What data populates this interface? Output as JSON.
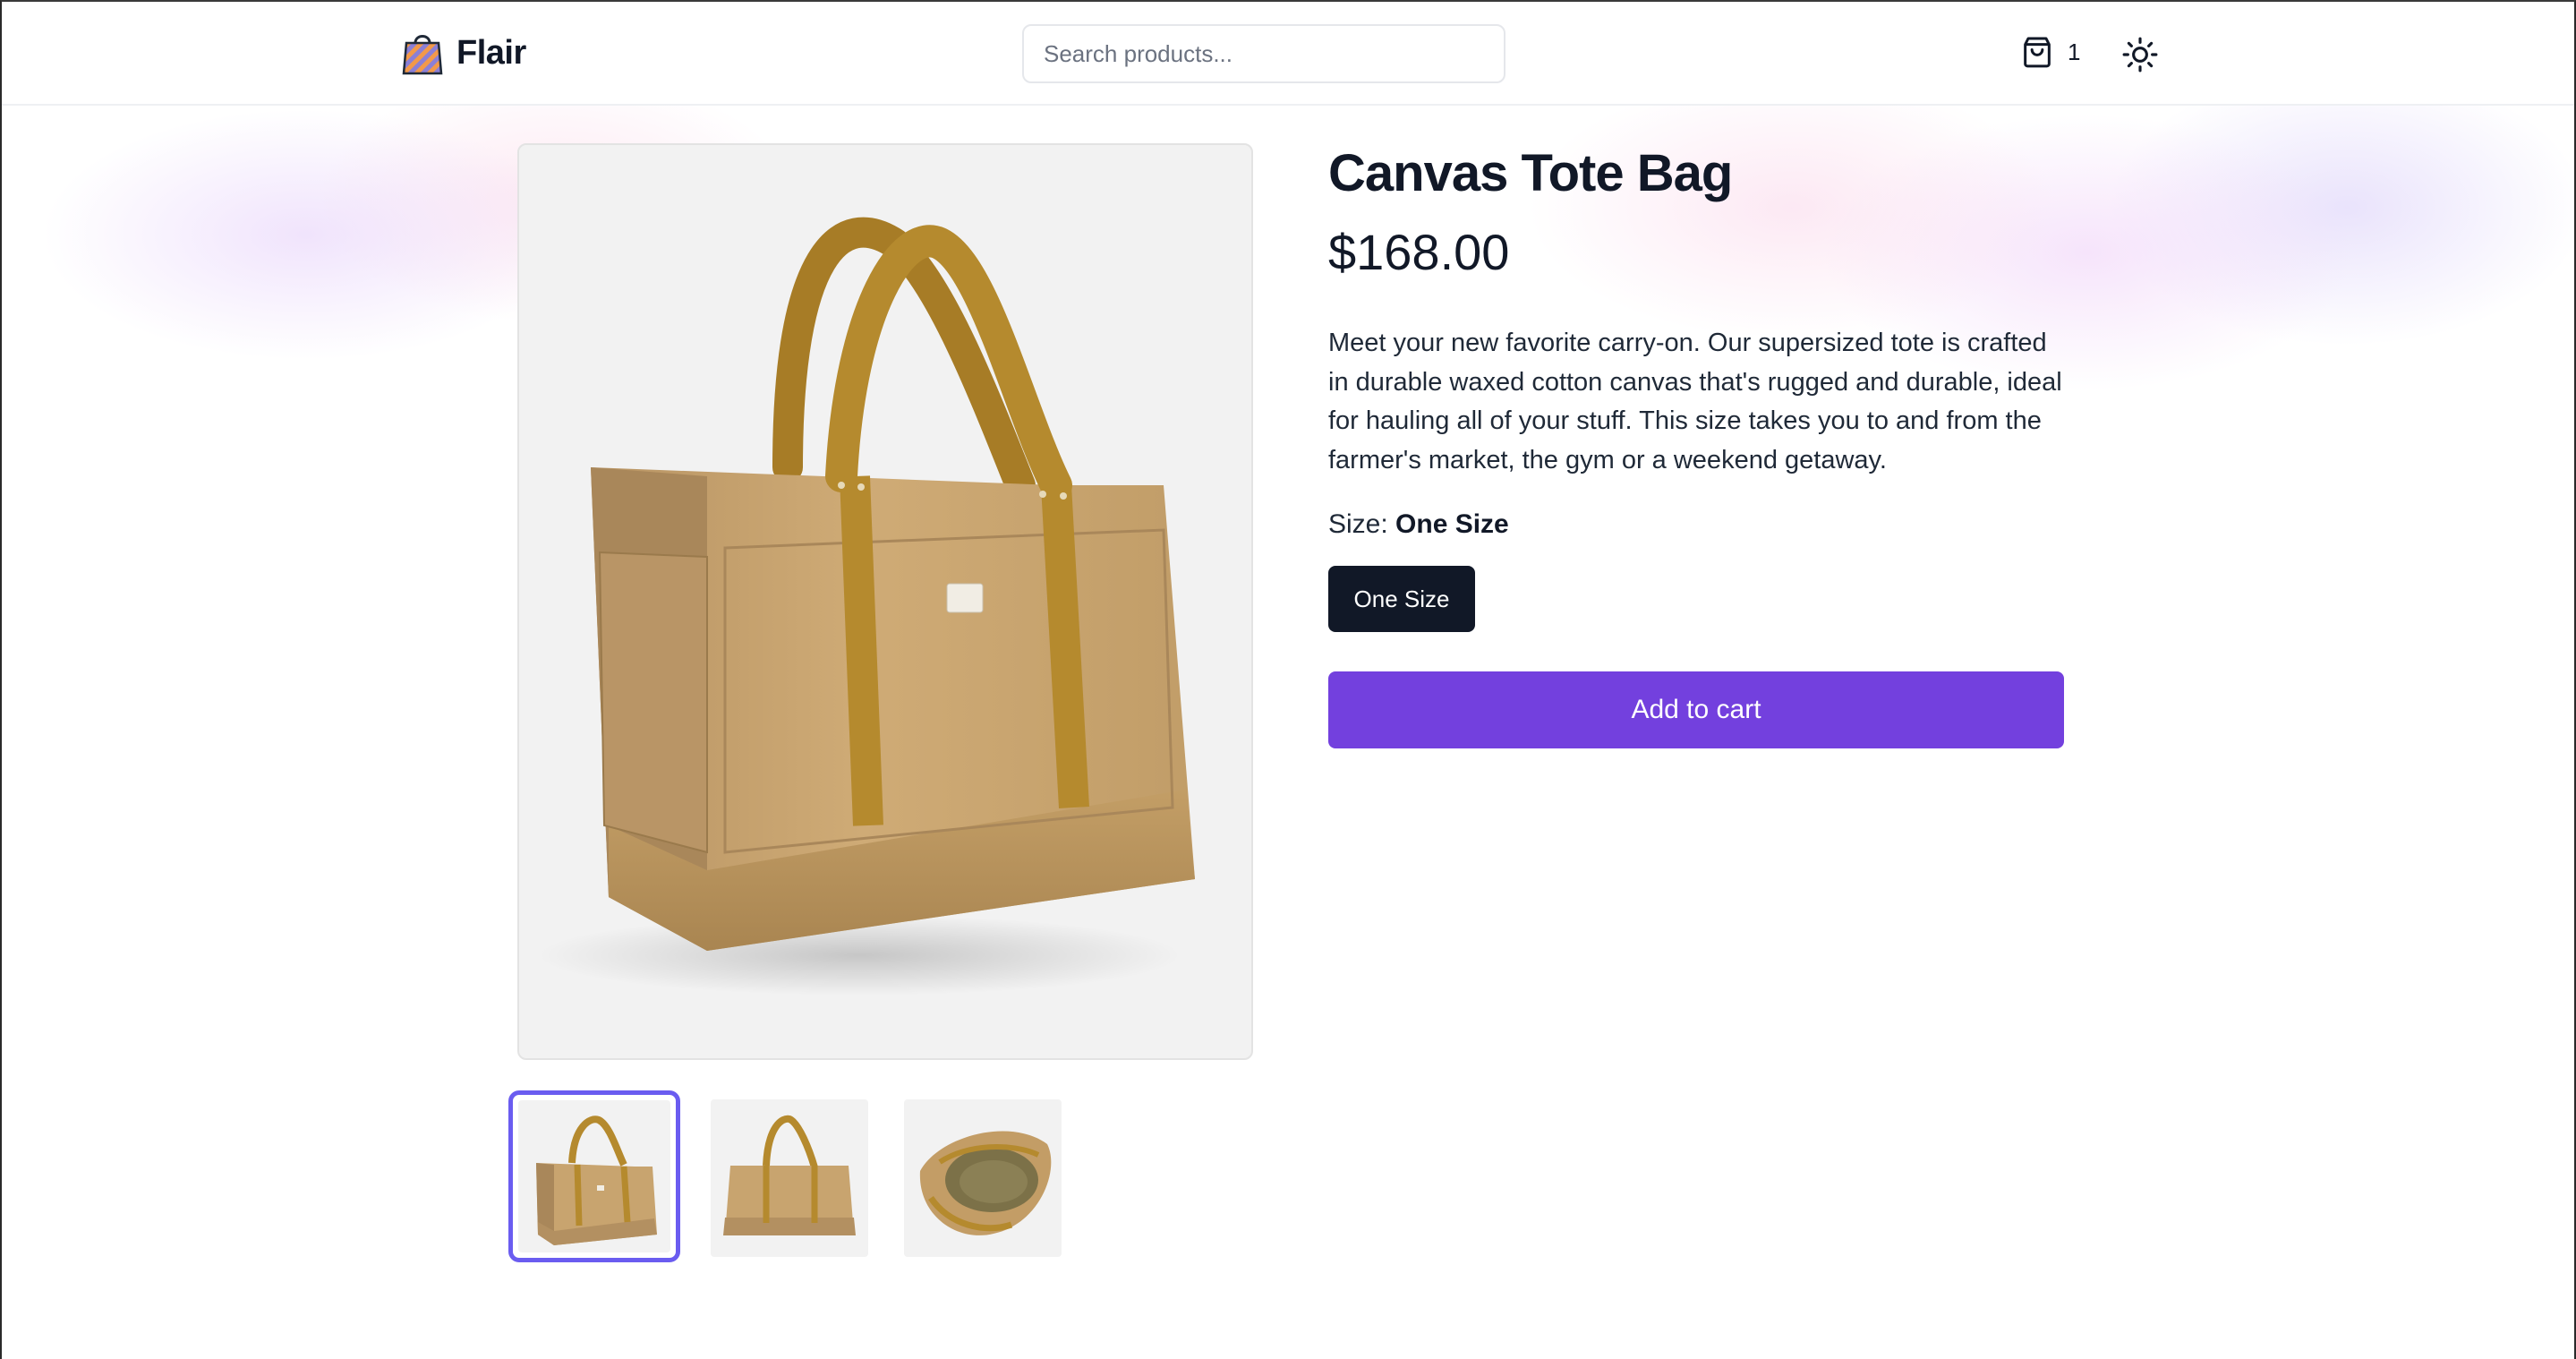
{
  "header": {
    "brand": "Flair",
    "search": {
      "placeholder": "Search products...",
      "value": ""
    },
    "cart": {
      "count": "1",
      "icon": "shopping-bag-icon"
    },
    "theme_toggle": {
      "icon": "sun-icon"
    }
  },
  "product": {
    "title": "Canvas Tote Bag",
    "price": "$168.00",
    "description": "Meet your new favorite carry-on. Our supersized tote is crafted in durable waxed cotton canvas that's rugged and durable, ideal for hauling all of your stuff. This size takes you to and from the farmer's market, the gym or a weekend getaway.",
    "size_label": "Size:",
    "selected_size": "One Size",
    "size_options": [
      "One Size"
    ],
    "add_to_cart_label": "Add to cart",
    "gallery": {
      "selected_index": 0,
      "thumbnails": [
        "tote-front-view",
        "tote-back-view",
        "tote-open-top-view"
      ]
    }
  },
  "colors": {
    "accent": "#7340de",
    "selected_thumb_border": "#6a5cf0",
    "dark_button": "#111827",
    "canvas": "#c9a56f",
    "strap": "#b58a2e"
  }
}
